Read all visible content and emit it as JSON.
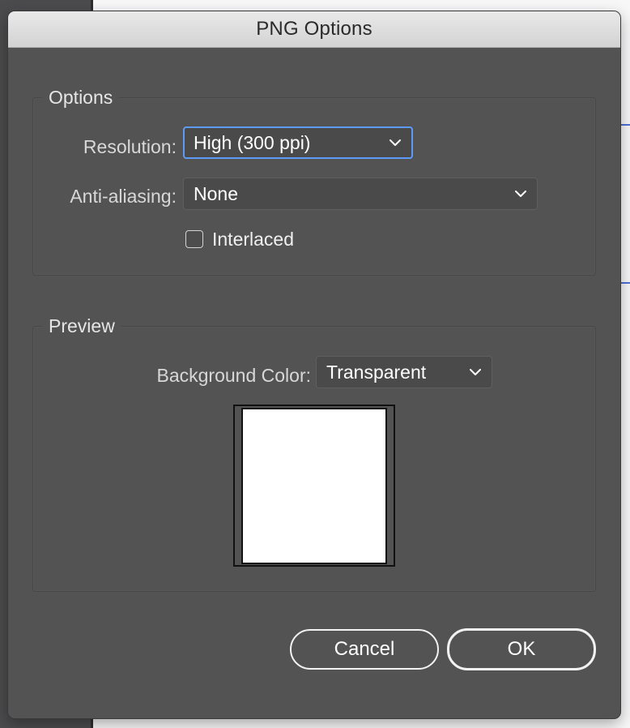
{
  "dialog": {
    "title": "PNG Options"
  },
  "options": {
    "legend": "Options",
    "resolution": {
      "label": "Resolution:",
      "value": "High (300 ppi)"
    },
    "antialiasing": {
      "label": "Anti-aliasing:",
      "value": "None"
    },
    "interlaced": {
      "label": "Interlaced",
      "checked": false
    }
  },
  "preview": {
    "legend": "Preview",
    "background_color": {
      "label": "Background Color:",
      "value": "Transparent"
    }
  },
  "buttons": {
    "cancel": "Cancel",
    "ok": "OK"
  },
  "icons": {
    "dropdown": "chevron-down-icon"
  },
  "colors": {
    "panel": "#535353",
    "focus": "#5e9bf6",
    "text": "#ffffff"
  }
}
